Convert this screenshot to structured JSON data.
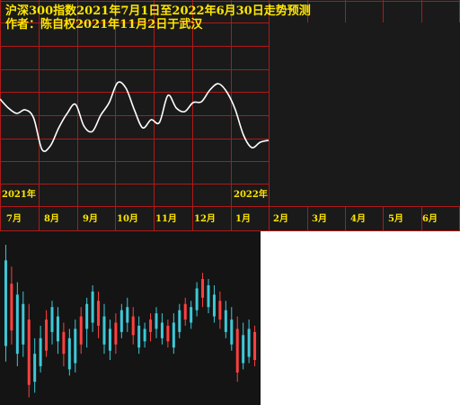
{
  "header": {
    "title": "沪深300指数2021年7月1日至2022年6月30日走势预测",
    "author": "作者：陈自权2021年11月2日于武汉"
  },
  "year_labels": [
    "2021年",
    "2022年"
  ],
  "months": [
    "7月",
    "8月",
    "9月",
    "10月",
    "11月",
    "12月",
    "1月",
    "2月",
    "3月",
    "4月",
    "5月",
    "6月"
  ],
  "colors": {
    "background": "#1a1a1a",
    "grid": "#b01818",
    "text": "#ffe600",
    "forecast_line": "#ffffff",
    "candle_up": "#ff4040",
    "candle_down": "#3ec8d8"
  },
  "chart_data": [
    {
      "type": "line",
      "x_labels": [
        "7月",
        "8月",
        "9月",
        "10月",
        "11月",
        "12月",
        "1月",
        "2月",
        "3月",
        "4月",
        "5月",
        "6月"
      ],
      "series": [
        {
          "values": [
            80,
            70,
            64,
            68,
            59,
            24,
            28,
            48,
            64,
            74,
            50,
            44,
            62,
            76,
            98,
            92,
            68,
            48,
            57,
            54,
            84,
            70,
            66,
            76,
            77,
            90,
            97,
            88,
            69,
            40,
            26,
            32,
            34
          ]
        }
      ]
    },
    {
      "type": "candlestick",
      "candles": [
        [
          1.0,
          0.25,
          0.35,
          0.9
        ],
        [
          0.86,
          0.36,
          0.45,
          0.75
        ],
        [
          0.76,
          0.22,
          0.3,
          0.68
        ],
        [
          0.7,
          0.28,
          0.36,
          0.62
        ],
        [
          0.62,
          0.02,
          0.1,
          0.52
        ],
        [
          0.4,
          0.05,
          0.12,
          0.3
        ],
        [
          0.48,
          0.18,
          0.22,
          0.4
        ],
        [
          0.58,
          0.28,
          0.32,
          0.52
        ],
        [
          0.64,
          0.36,
          0.44,
          0.6
        ],
        [
          0.6,
          0.3,
          0.38,
          0.54
        ],
        [
          0.5,
          0.22,
          0.3,
          0.44
        ],
        [
          0.46,
          0.16,
          0.2,
          0.4
        ],
        [
          0.52,
          0.18,
          0.24,
          0.46
        ],
        [
          0.6,
          0.3,
          0.36,
          0.54
        ],
        [
          0.66,
          0.34,
          0.46,
          0.62
        ],
        [
          0.74,
          0.44,
          0.5,
          0.7
        ],
        [
          0.7,
          0.4,
          0.48,
          0.64
        ],
        [
          0.62,
          0.3,
          0.36,
          0.54
        ],
        [
          0.52,
          0.26,
          0.32,
          0.46
        ],
        [
          0.56,
          0.3,
          0.36,
          0.5
        ],
        [
          0.62,
          0.4,
          0.44,
          0.58
        ],
        [
          0.66,
          0.44,
          0.5,
          0.6
        ],
        [
          0.6,
          0.36,
          0.42,
          0.54
        ],
        [
          0.54,
          0.3,
          0.34,
          0.48
        ],
        [
          0.5,
          0.34,
          0.38,
          0.46
        ],
        [
          0.56,
          0.38,
          0.44,
          0.52
        ],
        [
          0.6,
          0.4,
          0.46,
          0.56
        ],
        [
          0.56,
          0.36,
          0.4,
          0.5
        ],
        [
          0.52,
          0.34,
          0.38,
          0.48
        ],
        [
          0.56,
          0.3,
          0.34,
          0.5
        ],
        [
          0.62,
          0.4,
          0.44,
          0.58
        ],
        [
          0.66,
          0.48,
          0.52,
          0.62
        ],
        [
          0.64,
          0.46,
          0.5,
          0.6
        ],
        [
          0.76,
          0.54,
          0.58,
          0.72
        ],
        [
          0.82,
          0.6,
          0.66,
          0.78
        ],
        [
          0.78,
          0.56,
          0.6,
          0.74
        ],
        [
          0.74,
          0.5,
          0.54,
          0.68
        ],
        [
          0.7,
          0.46,
          0.52,
          0.64
        ],
        [
          0.64,
          0.4,
          0.44,
          0.58
        ],
        [
          0.6,
          0.32,
          0.36,
          0.52
        ],
        [
          0.54,
          0.12,
          0.18,
          0.46
        ],
        [
          0.5,
          0.2,
          0.24,
          0.42
        ],
        [
          0.52,
          0.24,
          0.28,
          0.46
        ],
        [
          0.48,
          0.22,
          0.26,
          0.44
        ]
      ]
    }
  ]
}
